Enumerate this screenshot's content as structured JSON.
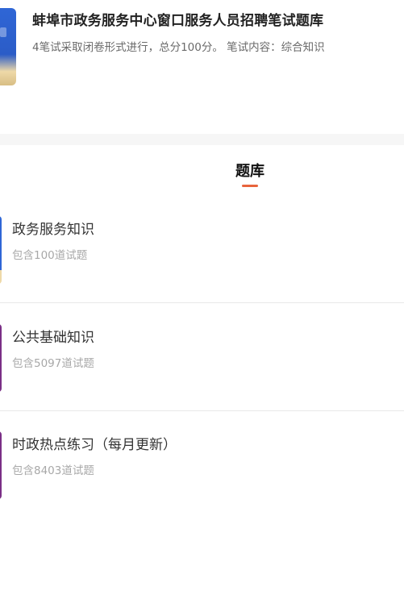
{
  "header": {
    "title": "蚌埠市政务服务中心窗口服务人员招聘笔试题库",
    "description": "4笔试采取闭卷形式进行，总分100分。 笔试内容：综合知识",
    "cover_icon": "book-cover-icon"
  },
  "section": {
    "title": "题库"
  },
  "banks": [
    {
      "name": "政务服务知识",
      "count": "包含100道试题",
      "thumb_color": "#2f66d6",
      "thumb_accent": "#eed9a8"
    },
    {
      "name": "公共基础知识",
      "count": "包含5097道试题",
      "thumb_color": "#7a2f86"
    },
    {
      "name": "时政热点练习（每月更新）",
      "count": "包含8403道试题",
      "thumb_color": "#7a2f86"
    }
  ],
  "colors": {
    "accent": "#e8643c",
    "title_text": "#222222",
    "muted_text": "#a8a8a8"
  }
}
